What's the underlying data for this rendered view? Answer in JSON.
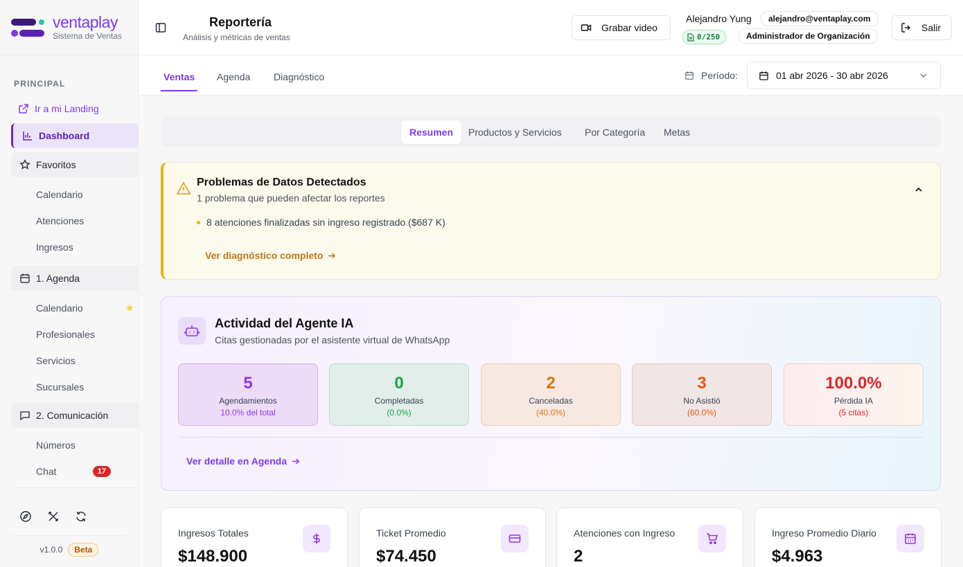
{
  "brand": {
    "name": "ventaplay",
    "subtitle": "Sistema de Ventas"
  },
  "sidebar": {
    "section": "PRINCIPAL",
    "landing_link": "Ir a mi Landing",
    "dashboard": "Dashboard",
    "favoritos": {
      "label": "Favoritos",
      "items": [
        "Calendario",
        "Atenciones",
        "Ingresos"
      ]
    },
    "agenda": {
      "label": "1. Agenda",
      "items": [
        "Calendario",
        "Profesionales",
        "Servicios",
        "Sucursales"
      ]
    },
    "comunicacion": {
      "label": "2. Comunicación",
      "items": [
        "Números",
        "Chat"
      ],
      "chat_badge": "17"
    },
    "version": "v1.0.0",
    "beta": "Beta"
  },
  "header": {
    "title": "Reportería",
    "subtitle": "Análisis y métricas de ventas",
    "record_label": "Grabar video",
    "user_name": "Alejandro Yung",
    "user_email": "alejandro@ventaplay.com",
    "quota": "0/250",
    "role": "Administrador de Organización",
    "logout_label": "Salir"
  },
  "main_tabs": [
    "Ventas",
    "Agenda",
    "Diagnóstico"
  ],
  "period": {
    "label": "Período:",
    "value": "01 abr 2026 - 30 abr 2026"
  },
  "sub_tabs": [
    "Resumen",
    "Productos y Servicios",
    "Por Categoría",
    "Metas"
  ],
  "warning": {
    "title": "Problemas de Datos Detectados",
    "subtitle": "1 problema que pueden afectar los reportes",
    "items": [
      "8 atenciones finalizadas sin ingreso registrado ($687 K)"
    ],
    "link": "Ver diagnóstico completo"
  },
  "ai_agent": {
    "title": "Actividad del Agente IA",
    "subtitle": "Citas gestionadas por el asistente virtual de WhatsApp",
    "stats": [
      {
        "value": "5",
        "label": "Agendamientos",
        "pct": "10.0% del total"
      },
      {
        "value": "0",
        "label": "Completadas",
        "pct": "(0.0%)"
      },
      {
        "value": "2",
        "label": "Canceladas",
        "pct": "(40.0%)"
      },
      {
        "value": "3",
        "label": "No Asistió",
        "pct": "(60.0%)"
      },
      {
        "value": "100.0%",
        "label": "Pérdida IA",
        "pct": "(5 citas)"
      }
    ],
    "link": "Ver detalle en Agenda"
  },
  "kpis": [
    {
      "label": "Ingresos Totales",
      "value": "$148.900",
      "icon": "dollar-icon"
    },
    {
      "label": "Ticket Promedio",
      "value": "$74.450",
      "icon": "credit-card-icon"
    },
    {
      "label": "Atenciones con Ingreso",
      "value": "2",
      "icon": "cart-icon"
    },
    {
      "label": "Ingreso Promedio Diario",
      "value": "$4.963",
      "icon": "calendar-icon"
    }
  ],
  "colors": {
    "accent": "#7c3aed",
    "warning": "#eab308",
    "danger": "#dc2626"
  }
}
